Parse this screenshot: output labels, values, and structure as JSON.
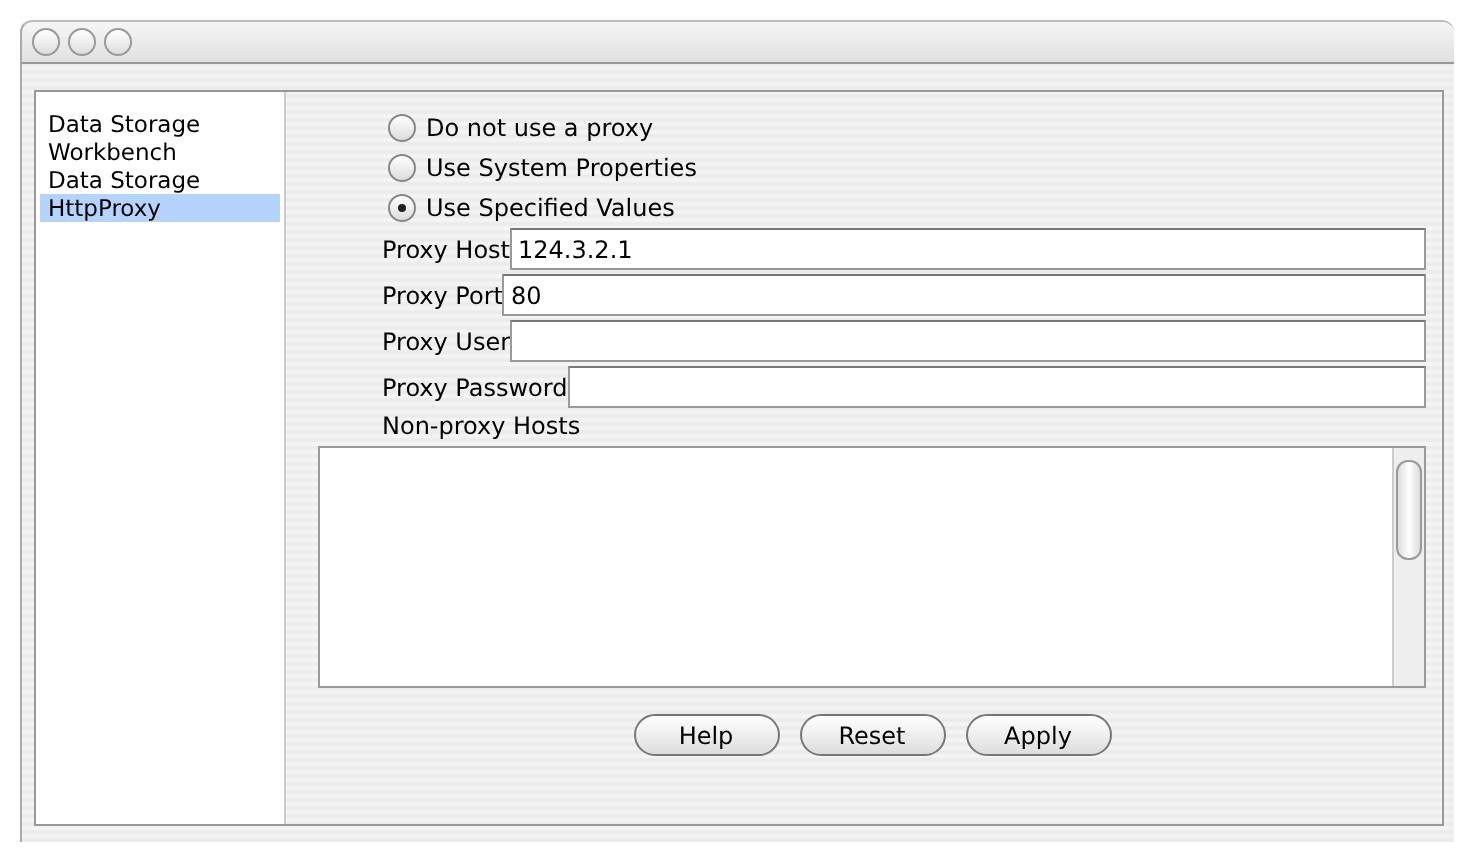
{
  "sidebar": {
    "items": [
      {
        "label": "Data Storage",
        "selected": false
      },
      {
        "label": "Workbench",
        "selected": false
      },
      {
        "label": "Data Storage",
        "selected": false
      },
      {
        "label": "HttpProxy",
        "selected": true
      }
    ]
  },
  "proxy_options": [
    {
      "label": "Do not use a proxy",
      "selected": false
    },
    {
      "label": "Use System Properties",
      "selected": false
    },
    {
      "label": "Use Specified Values",
      "selected": true
    }
  ],
  "fields": [
    {
      "label": "Proxy Host",
      "value": "124.3.2.1"
    },
    {
      "label": "Proxy Port",
      "value": "80"
    },
    {
      "label": "Proxy User"
    },
    {
      "label": "Proxy Password"
    }
  ],
  "non_proxy_hosts": {
    "label": "Non-proxy Hosts"
  },
  "buttons": [
    "Help",
    "Reset",
    "Apply"
  ]
}
